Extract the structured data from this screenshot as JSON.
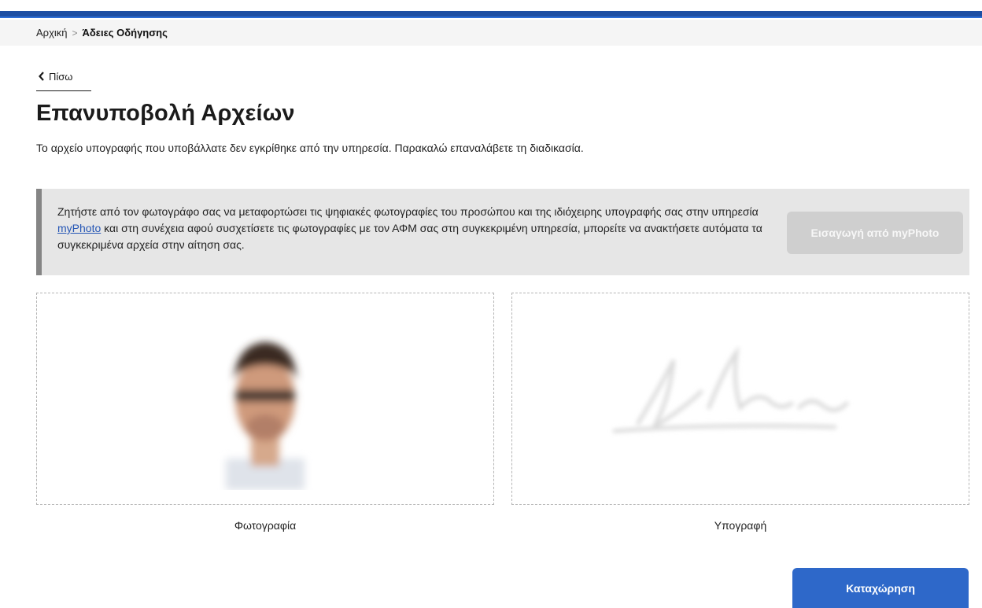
{
  "breadcrumb": {
    "home": "Αρχική",
    "separator": ">",
    "current": "Άδειες Οδήγησης"
  },
  "back": {
    "chevron_icon": "chevron-left-icon",
    "label": "Πίσω"
  },
  "page": {
    "title": "Επανυποβολή Αρχείων",
    "description": "Το αρχείο υπογραφής που υποβάλλατε δεν εγκρίθηκε από την υπηρεσία. Παρακαλώ επαναλάβετε τη διαδικασία."
  },
  "info": {
    "text_before_link": "Ζητήστε από τον φωτογράφο σας να μεταφορτώσει τις ψηφιακές φωτογραφίες του προσώπου και της ιδιόχειρης υπογραφής σας στην υπηρεσία ",
    "link_text": "myPhoto",
    "text_after_link": " και στη συνέχεια αφού συσχετίσετε τις φωτογραφίες με τον ΑΦΜ σας στη συγκεκριμένη υπηρεσία, μπορείτε να ανακτήσετε αυτόματα τα συγκεκριμένα αρχεία στην αίτηση σας.",
    "import_button": "Εισαγωγή από myPhoto",
    "import_button_state": "disabled"
  },
  "uploads": {
    "photo_caption": "Φωτογραφία",
    "signature_caption": "Υπογραφή"
  },
  "actions": {
    "submit": "Καταχώρηση"
  },
  "colors": {
    "header_blue": "#1e4fa3",
    "primary_button": "#2e68c9",
    "disabled_button": "#cfcfcf",
    "info_background": "#e6e6e6",
    "info_border": "#858585",
    "link": "#2556b5"
  }
}
